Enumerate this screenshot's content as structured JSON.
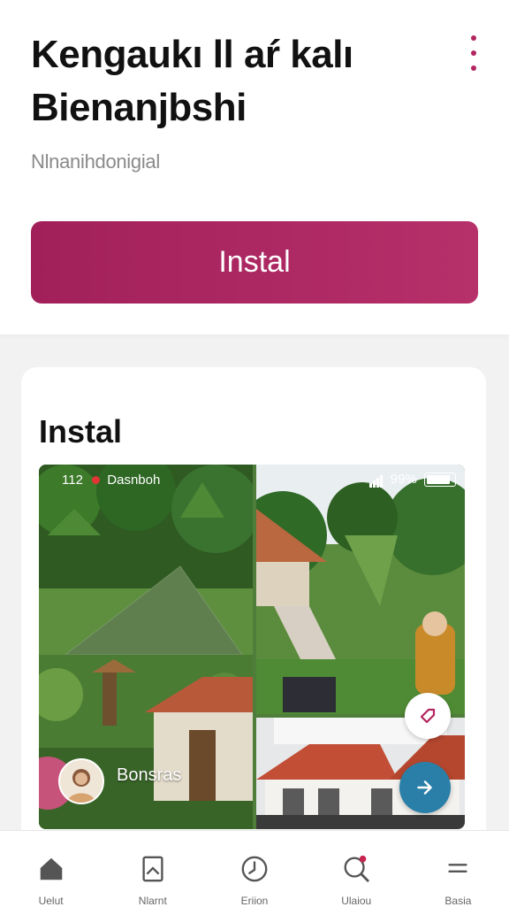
{
  "header": {
    "title_line1": "Kengaukı ll aŕ kalı",
    "title_line2": "Bienanjbshi",
    "subtitle": "Nlnanihdonigial",
    "install_label": "Instal"
  },
  "card": {
    "title": "Instal",
    "statusbar": {
      "time": "112",
      "carrier": "Dasnboh",
      "battery": "99%"
    },
    "gallery_label": "Bonsras"
  },
  "navbar": {
    "items": [
      {
        "label": "Uelut",
        "icon": "home-icon"
      },
      {
        "label": "Nlarnt",
        "icon": "bookmark-icon"
      },
      {
        "label": "Eriion",
        "icon": "clock-icon"
      },
      {
        "label": "Ulaiou",
        "icon": "search-icon"
      },
      {
        "label": "Basia",
        "icon": "menu-icon"
      }
    ]
  },
  "colors": {
    "accent": "#a8235d",
    "fab_blue": "#2a7fa8"
  }
}
